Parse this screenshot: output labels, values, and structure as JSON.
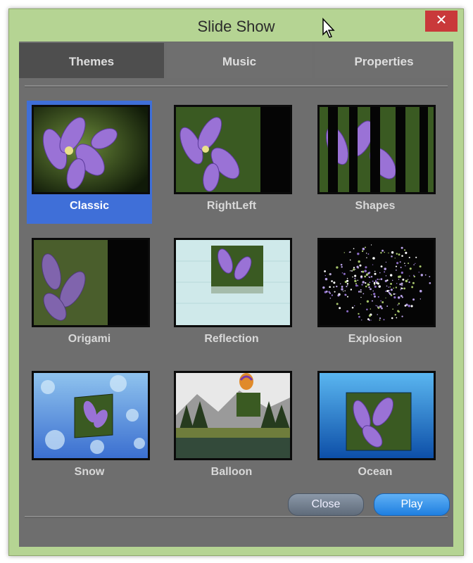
{
  "window": {
    "title": "Slide Show",
    "close_glyph": "✕"
  },
  "tabs": [
    {
      "label": "Themes",
      "active": true
    },
    {
      "label": "Music",
      "active": false
    },
    {
      "label": "Properties",
      "active": false
    }
  ],
  "themes": [
    {
      "label": "Classic",
      "selected": true
    },
    {
      "label": "RightLeft",
      "selected": false
    },
    {
      "label": "Shapes",
      "selected": false
    },
    {
      "label": "Origami",
      "selected": false
    },
    {
      "label": "Reflection",
      "selected": false
    },
    {
      "label": "Explosion",
      "selected": false
    },
    {
      "label": "Snow",
      "selected": false
    },
    {
      "label": "Balloon",
      "selected": false
    },
    {
      "label": "Ocean",
      "selected": false
    }
  ],
  "buttons": {
    "close": "Close",
    "play": "Play"
  },
  "colors": {
    "frame": "#b5d493",
    "panel": "#6e6e6e",
    "selection": "#3f6fd8",
    "close_x": "#c9393a",
    "play": "#1f7fe0"
  }
}
